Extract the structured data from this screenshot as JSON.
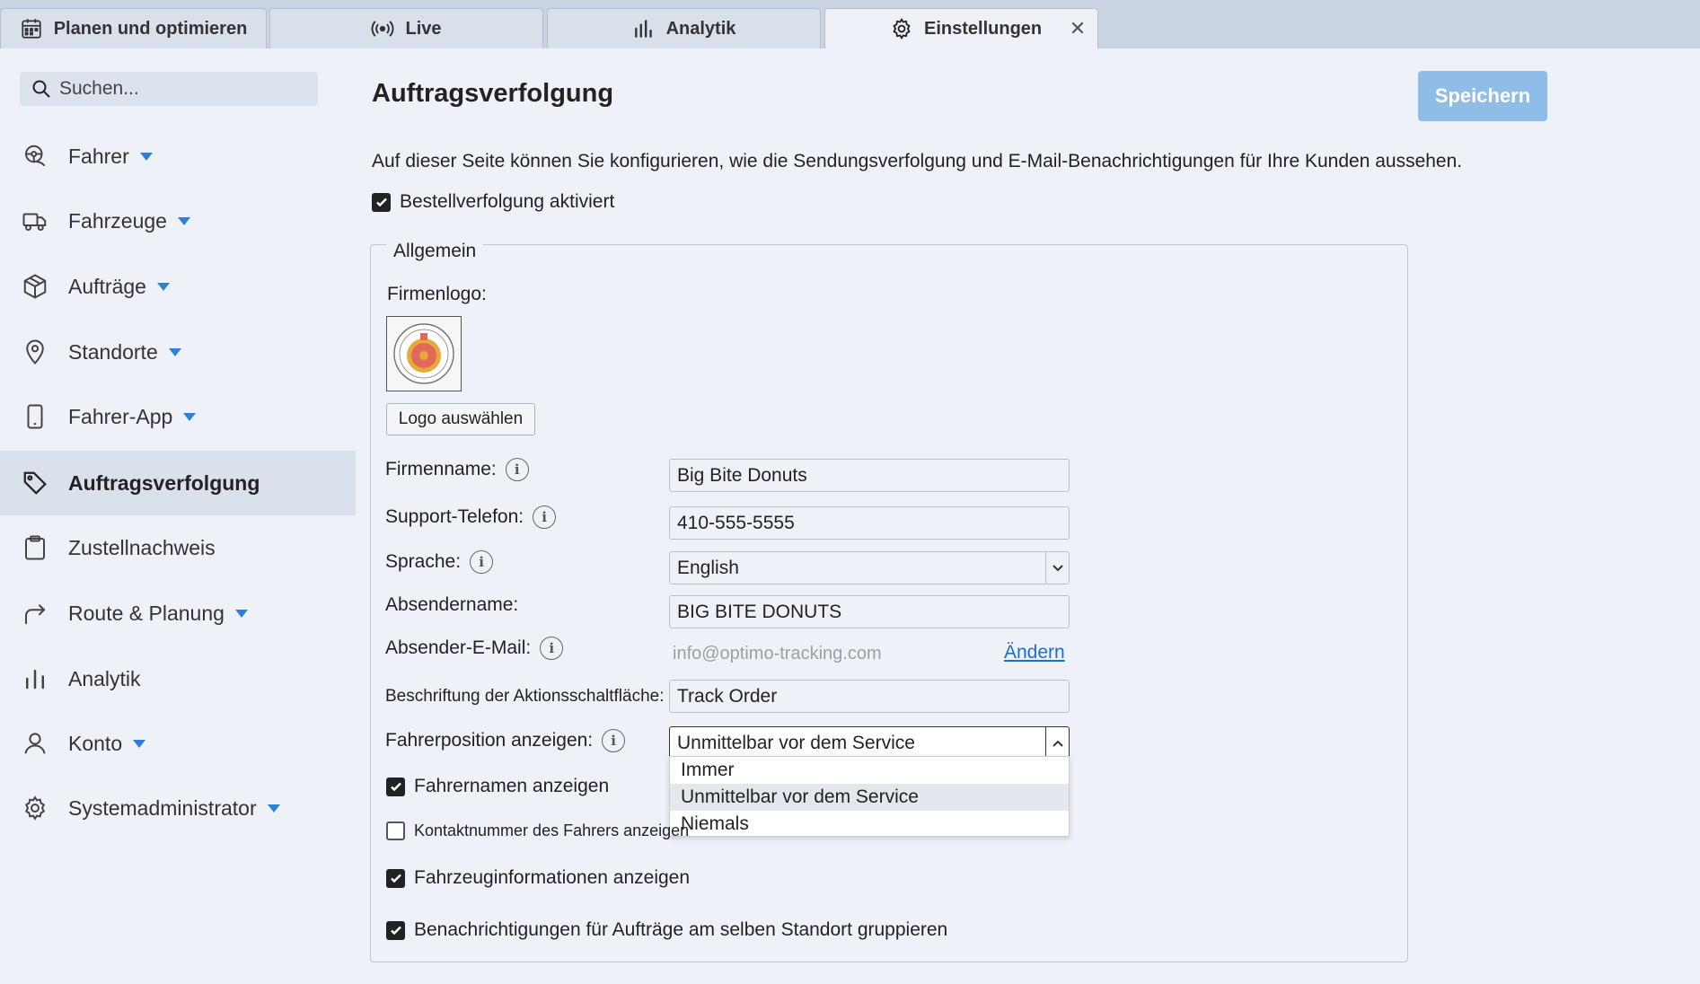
{
  "tabs": [
    {
      "label": "Planen und optimieren",
      "icon": "calendar-icon"
    },
    {
      "label": "Live",
      "icon": "broadcast-icon"
    },
    {
      "label": "Analytik",
      "icon": "bar-chart-icon"
    },
    {
      "label": "Einstellungen",
      "icon": "gear-icon",
      "active": true
    }
  ],
  "tab_close": "✕",
  "sidebar": {
    "search_placeholder": "Suchen...",
    "items": [
      {
        "label": "Fahrer",
        "icon": "driver-icon",
        "caret": true
      },
      {
        "label": "Fahrzeuge",
        "icon": "truck-icon",
        "caret": true
      },
      {
        "label": "Aufträge",
        "icon": "package-icon",
        "caret": true
      },
      {
        "label": "Standorte",
        "icon": "location-pin-icon",
        "caret": true
      },
      {
        "label": "Fahrer-App",
        "icon": "phone-icon",
        "caret": true
      },
      {
        "label": "Auftragsverfolgung",
        "icon": "tag-icon",
        "active": true
      },
      {
        "label": "Zustellnachweis",
        "icon": "clipboard-icon"
      },
      {
        "label": "Route & Planung",
        "icon": "route-arrow-icon",
        "caret": true
      },
      {
        "label": "Analytik",
        "icon": "bar-chart-icon"
      },
      {
        "label": "Konto",
        "icon": "user-icon",
        "caret": true
      },
      {
        "label": "Systemadministrator",
        "icon": "gear-icon",
        "caret": true
      }
    ]
  },
  "main": {
    "title": "Auftragsverfolgung",
    "save_label": "Speichern",
    "description": "Auf dieser Seite können Sie konfigurieren, wie die Sendungsverfolgung und E-Mail-Benachrichtigungen für Ihre Kunden aussehen.",
    "tracking_enabled_label": "Bestellverfolgung aktiviert",
    "general_legend": "Allgemein",
    "logo_label": "Firmenlogo:",
    "logo_button": "Logo auswählen",
    "company_name_label": "Firmenname:",
    "company_name_value": "Big Bite Donuts",
    "support_phone_label": "Support-Telefon:",
    "support_phone_value": "410-555-5555",
    "language_label": "Sprache:",
    "language_value": "English",
    "sender_name_label": "Absendername:",
    "sender_name_value": "BIG BITE DONUTS",
    "sender_email_label": "Absender-E-Mail:",
    "sender_email_value": "info@optimo-tracking.com",
    "change_link": "Ändern",
    "action_button_label": "Beschriftung der Aktionsschaltfläche:",
    "action_button_value": "Track Order",
    "driver_position_label": "Fahrerposition anzeigen:",
    "driver_position_value": "Unmittelbar vor dem Service",
    "driver_position_options": [
      "Immer",
      "Unmittelbar vor dem Service",
      "Niemals"
    ],
    "show_driver_name_label": "Fahrernamen anzeigen",
    "show_driver_contact_label": "Kontaktnummer des Fahrers anzeigen",
    "show_vehicle_info_label": "Fahrzeuginformationen anzeigen",
    "group_notifications_label": "Benachrichtigungen für Aufträge am selben Standort gruppieren"
  },
  "colors": {
    "accent": "#2f7fd6",
    "save_button": "#8fbde8",
    "link": "#1a6fd1"
  }
}
